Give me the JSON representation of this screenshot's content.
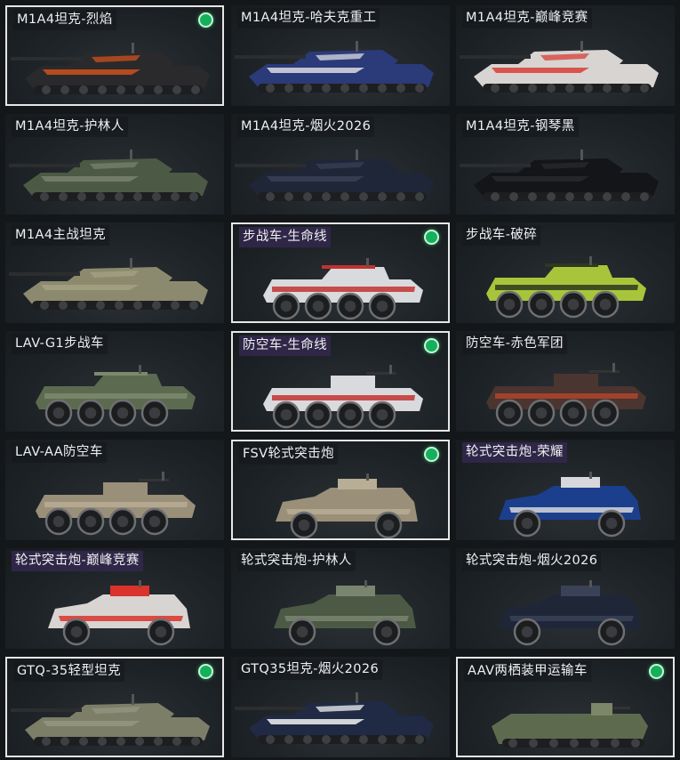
{
  "vehicles": [
    {
      "name": "M1A4坦克-烈焰",
      "type": "tank",
      "paint": "flame",
      "selected": true,
      "equipped": true,
      "highlight": false
    },
    {
      "name": "M1A4坦克-哈夫克重工",
      "type": "tank",
      "paint": "haavk",
      "selected": false,
      "equipped": false,
      "highlight": false
    },
    {
      "name": "M1A4坦克-巅峰竞赛",
      "type": "tank",
      "paint": "race",
      "selected": false,
      "equipped": false,
      "highlight": false
    },
    {
      "name": "M1A4坦克-护林人",
      "type": "tank",
      "paint": "forest",
      "selected": false,
      "equipped": false,
      "highlight": false
    },
    {
      "name": "M1A4坦克-烟火2026",
      "type": "tank",
      "paint": "firework",
      "selected": false,
      "equipped": false,
      "highlight": false
    },
    {
      "name": "M1A4坦克-钢琴黑",
      "type": "tank",
      "paint": "black",
      "selected": false,
      "equipped": false,
      "highlight": false
    },
    {
      "name": "M1A4主战坦克",
      "type": "tank",
      "paint": "desert",
      "selected": false,
      "equipped": false,
      "highlight": false
    },
    {
      "name": "步战车-生命线",
      "type": "ifv",
      "paint": "lifeline",
      "selected": true,
      "equipped": true,
      "highlight": true
    },
    {
      "name": "步战车-破碎",
      "type": "ifv",
      "paint": "shatter",
      "selected": false,
      "equipped": false,
      "highlight": false
    },
    {
      "name": "LAV-G1步战车",
      "type": "ifv",
      "paint": "green",
      "selected": false,
      "equipped": false,
      "highlight": false
    },
    {
      "name": "防空车-生命线",
      "type": "aa",
      "paint": "lifeline",
      "selected": true,
      "equipped": true,
      "highlight": true
    },
    {
      "name": "防空车-赤色军团",
      "type": "aa",
      "paint": "redlegion",
      "selected": false,
      "equipped": false,
      "highlight": false
    },
    {
      "name": "LAV-AA防空车",
      "type": "aa",
      "paint": "tan",
      "selected": false,
      "equipped": false,
      "highlight": false
    },
    {
      "name": "FSV轮式突击炮",
      "type": "fsv",
      "paint": "tan",
      "selected": true,
      "equipped": true,
      "highlight": false
    },
    {
      "name": "轮式突击炮-荣耀",
      "type": "fsv",
      "paint": "glory",
      "selected": false,
      "equipped": false,
      "highlight": true
    },
    {
      "name": "轮式突击炮-巅峰竞赛",
      "type": "fsv",
      "paint": "race",
      "selected": false,
      "equipped": false,
      "highlight": true
    },
    {
      "name": "轮式突击炮-护林人",
      "type": "fsv",
      "paint": "forest",
      "selected": false,
      "equipped": false,
      "highlight": false
    },
    {
      "name": "轮式突击炮-烟火2026",
      "type": "fsv",
      "paint": "firework",
      "selected": false,
      "equipped": false,
      "highlight": false
    },
    {
      "name": "GTQ-35轻型坦克",
      "type": "lighttank",
      "paint": "olive",
      "selected": true,
      "equipped": true,
      "highlight": false
    },
    {
      "name": "GTQ35坦克-烟火2026",
      "type": "lighttank",
      "paint": "firework2026",
      "selected": false,
      "equipped": false,
      "highlight": false
    },
    {
      "name": "AAV两栖装甲运输车",
      "type": "aav",
      "paint": "olivegreen",
      "selected": true,
      "equipped": true,
      "highlight": false
    }
  ],
  "paint_colors": {
    "flame": [
      "#2a2a2c",
      "#d9541b"
    ],
    "haavk": [
      "#2b3a78",
      "#e9e6ea"
    ],
    "race": [
      "#d8d4d2",
      "#d9332b"
    ],
    "forest": [
      "#4c5a45",
      "#7a8570"
    ],
    "firework": [
      "#1f2638",
      "#3a4258"
    ],
    "firework2026": [
      "#202a44",
      "#ffffff"
    ],
    "black": [
      "#141518",
      "#2a2b2e"
    ],
    "desert": [
      "#8c8a6e",
      "#a6a384"
    ],
    "lifeline": [
      "#d9dade",
      "#c2332f"
    ],
    "shatter": [
      "#a8c43a",
      "#2d3a1e"
    ],
    "green": [
      "#5c6b50",
      "#7b8a6c"
    ],
    "redlegion": [
      "#4a3530",
      "#b2442c"
    ],
    "tan": [
      "#9a8f78",
      "#b8ad95"
    ],
    "glory": [
      "#1b3f8c",
      "#d7d7dc"
    ],
    "olive": [
      "#7c7e68",
      "#969882"
    ],
    "olivegreen": [
      "#5e6a4e",
      "#7c8668"
    ]
  }
}
